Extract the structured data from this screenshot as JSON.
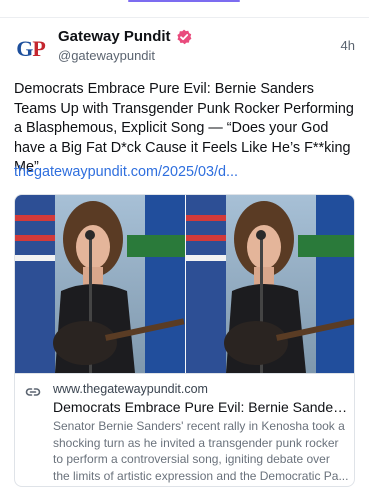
{
  "post": {
    "author": {
      "display_name": "Gateway Pundit",
      "handle": "@gatewaypundit",
      "verified": true,
      "avatar_letters": {
        "first": "G",
        "second": "P"
      }
    },
    "timestamp": "4h",
    "text": "Democrats Embrace Pure Evil: Bernie Sanders Teams Up with Transgender Punk Rocker Performing a Blasphemous, Explicit Song — “Does your God have a Big Fat D*ck Cause it Feels Like He’s F**king Me”",
    "link_text": "thegatewaypundit.com/2025/03/d...",
    "link_card": {
      "domain": "www.thegatewaypundit.com",
      "title": "Democrats Embrace Pure Evil: Bernie Sanders ...",
      "description": "Senator Bernie Sanders' recent rally in Kenosha took a shocking turn as he invited a transgender punk rocker to perform a controversial song, igniting debate over the limits of artistic expression and the Democratic Pa...",
      "icon": "link-icon"
    }
  },
  "icons": {
    "verified": "verified-badge-icon",
    "link": "link-icon"
  },
  "colors": {
    "accent": "#7c6cf0",
    "link": "#2f6fde",
    "verified": "#e94b7d",
    "border": "#dfe3e8"
  }
}
